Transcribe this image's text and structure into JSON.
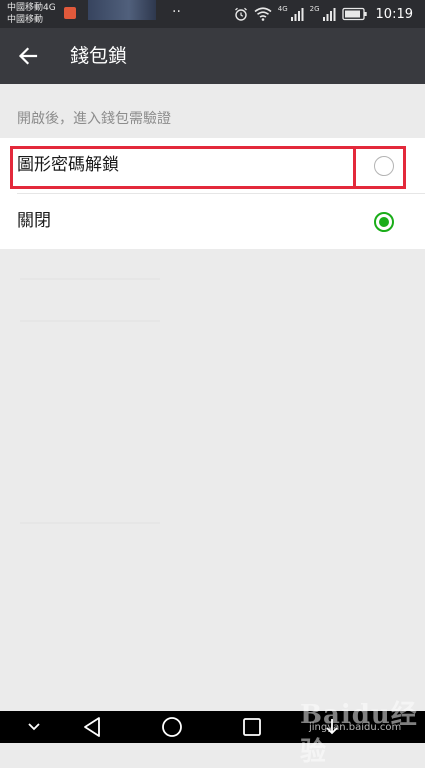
{
  "status_bar": {
    "carrier_1": "中國移動4G",
    "carrier_2": "中國移動",
    "dots": "··",
    "net_1": "4G",
    "net_2": "2G",
    "time": "10:19"
  },
  "app_bar": {
    "title": "錢包鎖"
  },
  "section": {
    "hint": "開啟後，進入錢包需驗證"
  },
  "options": [
    {
      "label": "圖形密碼解鎖",
      "selected": false
    },
    {
      "label": "關閉",
      "selected": true
    }
  ],
  "watermark": {
    "brand": "Baidu经验",
    "url": "jingyan.baidu.com"
  },
  "colors": {
    "accent_green": "#1aad19",
    "app_bar": "#393a3f",
    "highlight_red": "#e3293b"
  }
}
